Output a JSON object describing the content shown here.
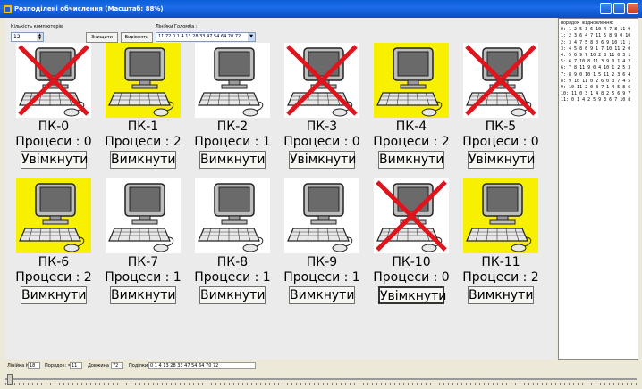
{
  "window": {
    "title": "Розподілені обчислення (Масштаб: 88%)"
  },
  "controls": {
    "count_label": "Кількість комп'ютерів:",
    "count_value": "12",
    "destroy_label": "Знищити",
    "align_label": "Вирівняти",
    "line_label": "Лінійки Голомба :",
    "line_value": "11 72 0 1 4 13 28 33 47 54 64 70 72"
  },
  "computers": [
    {
      "name": "ПК-0",
      "procs": "Процеси : 0",
      "button": "Увімкнути",
      "state": "off"
    },
    {
      "name": "ПК-1",
      "procs": "Процеси : 2",
      "button": "Вимкнути",
      "state": "busy"
    },
    {
      "name": "ПК-2",
      "procs": "Процеси : 1",
      "button": "Вимкнути",
      "state": "idle"
    },
    {
      "name": "ПК-3",
      "procs": "Процеси : 0",
      "button": "Увімкнути",
      "state": "off"
    },
    {
      "name": "ПК-4",
      "procs": "Процеси : 2",
      "button": "Вимкнути",
      "state": "busy"
    },
    {
      "name": "ПК-5",
      "procs": "Процеси : 0",
      "button": "Увімкнути",
      "state": "off"
    },
    {
      "name": "ПК-6",
      "procs": "Процеси : 2",
      "button": "Вимкнути",
      "state": "busy"
    },
    {
      "name": "ПК-7",
      "procs": "Процеси : 1",
      "button": "Вимкнути",
      "state": "idle"
    },
    {
      "name": "ПК-8",
      "procs": "Процеси : 1",
      "button": "Вимкнути",
      "state": "idle"
    },
    {
      "name": "ПК-9",
      "procs": "Процеси : 1",
      "button": "Вимкнути",
      "state": "idle"
    },
    {
      "name": "ПК-10",
      "procs": "Процеси : 0",
      "button": "Увімкнути",
      "state": "off"
    },
    {
      "name": "ПК-11",
      "procs": "Процеси : 2",
      "button": "Вимкнути",
      "state": "busy"
    }
  ],
  "recovery": {
    "title": "Порядок відновлення:",
    "lines": [
      "0: 1 2 5 3 6 10 4 7 8 11 9",
      "1: 2 3 6 4 7 11 5 8 9 0 10",
      "2: 3 4 7 5 8 0 6 9 10 11 1",
      "3: 4 5 8 6 9 1 7 10 11 2 0",
      "4: 5 6 9 7 10 2 8 11 0 3 1",
      "5: 6 7 10 8 11 3 9 0 1 4 2",
      "6: 7 8 11 9 0 4 10 1 2 5 3",
      "7: 8 9 0 10 1 5 11 2 3 6 4",
      "8: 9 10 11 0 2 6 0 3 7 4 5",
      "9: 10 11 2 0 3 7 1 4 5 8 6",
      "10: 11 0 3 1 4 8 2 5 6 9 7",
      "11: 0 1 4 2 5 9 3 6 7 10 8"
    ]
  },
  "status": {
    "line_no_label": "Лінійка №",
    "line_no": "18",
    "order_label": "Порядок: =",
    "order": "11",
    "length_label": "Довжина =",
    "length": "72",
    "marks_label": "Поділки :",
    "marks": "0 1 4 13 28 33 47 54 64 70 72"
  },
  "colors": {
    "busy_bg": "#f7f000",
    "cross": "#e0141c",
    "titlebar": "#1d6ce8"
  }
}
